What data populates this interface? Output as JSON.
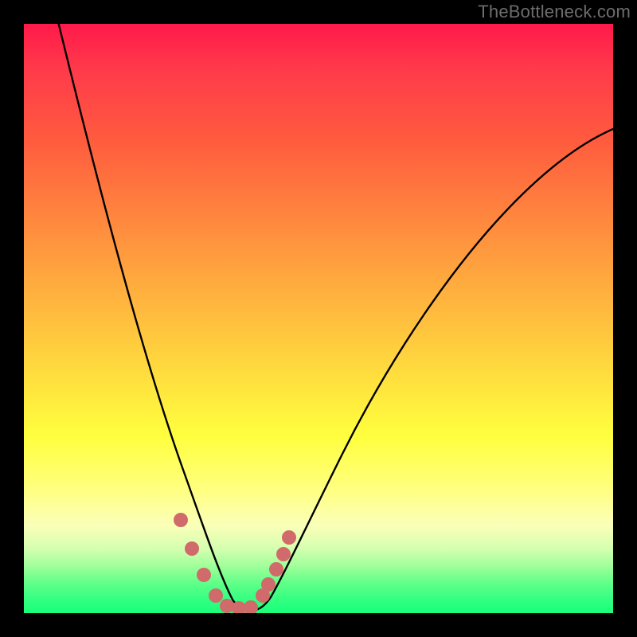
{
  "watermark": "TheBottleneck.com",
  "chart_data": {
    "type": "line",
    "title": "",
    "xlabel": "",
    "ylabel": "",
    "x": [
      0.0,
      0.05,
      0.1,
      0.15,
      0.2,
      0.25,
      0.28,
      0.3,
      0.32,
      0.34,
      0.36,
      0.38,
      0.4,
      0.42,
      0.45,
      0.5,
      0.55,
      0.6,
      0.65,
      0.7,
      0.75,
      0.8,
      0.85,
      0.9,
      0.95,
      1.0
    ],
    "y": [
      1.02,
      0.86,
      0.7,
      0.55,
      0.41,
      0.27,
      0.19,
      0.12,
      0.06,
      0.02,
      0.0,
      0.0,
      0.02,
      0.06,
      0.13,
      0.25,
      0.36,
      0.46,
      0.54,
      0.61,
      0.67,
      0.71,
      0.75,
      0.78,
      0.8,
      0.82
    ],
    "xlim": [
      0,
      1
    ],
    "ylim": [
      0,
      1
    ],
    "marker_points_x": [
      0.266,
      0.285,
      0.305,
      0.325,
      0.345,
      0.365,
      0.385,
      0.405,
      0.415,
      0.428,
      0.44,
      0.45
    ],
    "marker_points_y": [
      0.158,
      0.11,
      0.065,
      0.03,
      0.012,
      0.008,
      0.01,
      0.03,
      0.048,
      0.075,
      0.1,
      0.128
    ],
    "marker_color": "#d16a6a",
    "curve_color": "#000000",
    "background_gradient": [
      "#ff1a4a",
      "#ff5c3e",
      "#ffff3e",
      "#1aff78"
    ]
  }
}
